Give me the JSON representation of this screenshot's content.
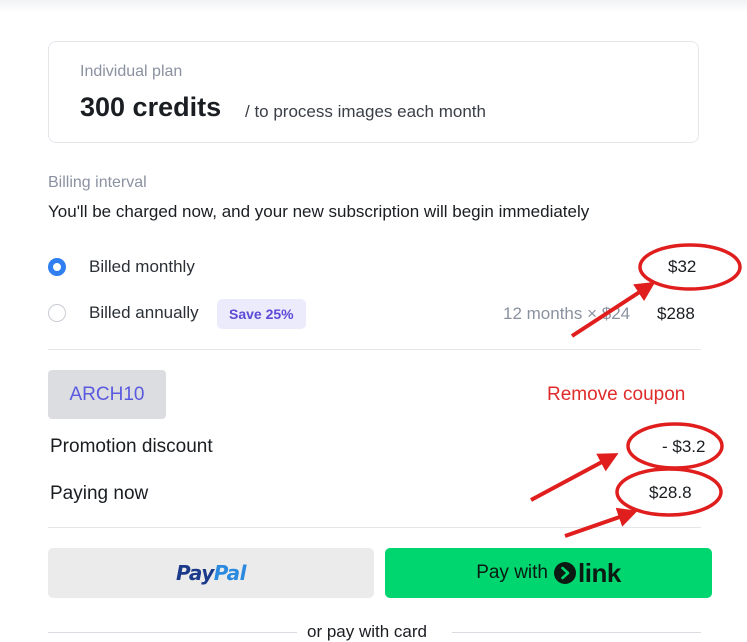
{
  "plan": {
    "name": "Individual plan",
    "credits": "300 credits",
    "description": "/ to process images each month"
  },
  "billing": {
    "title": "Billing interval",
    "description": "You'll be charged now, and your new subscription will begin immediately",
    "options": [
      {
        "label": "Billed monthly",
        "price": "$32",
        "selected": true
      },
      {
        "label": "Billed annually",
        "badge": "Save 25%",
        "detail": "12 months × $24",
        "price": "$288",
        "selected": false
      }
    ]
  },
  "coupon": {
    "code": "ARCH10",
    "remove_label": "Remove coupon"
  },
  "summary": {
    "discount_label": "Promotion discount",
    "discount_value": "- $3.2",
    "paying_label": "Paying now",
    "paying_value": "$28.8"
  },
  "payment": {
    "paypal_part1": "Pay",
    "paypal_part2": "Pal",
    "link_prefix": "Pay with",
    "link_word": "link",
    "or_text": "or pay with card"
  },
  "colors": {
    "accent_blue": "#2f7ff0",
    "link_green": "#00d66f",
    "remove_red": "#e02b2b",
    "annotation_red": "#e01e1e"
  },
  "icons": {
    "link_logo": "link-arrow-icon",
    "radio_selected": "radio-selected-icon",
    "radio_unselected": "radio-unselected-icon"
  }
}
